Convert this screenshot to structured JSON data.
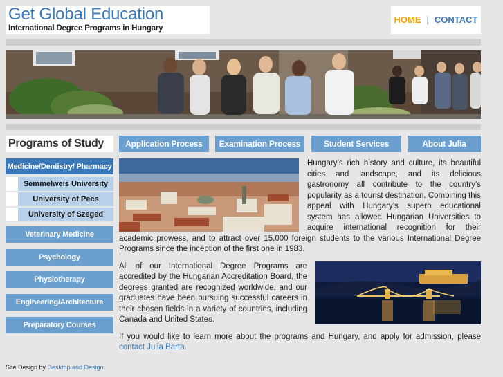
{
  "logo": {
    "title": "Get Global Education",
    "subtitle": "International Degree Programs in Hungary"
  },
  "topnav": {
    "home": "HOME",
    "separator": "|",
    "contact": "CONTACT"
  },
  "sidebar": {
    "heading": "Programs of Study",
    "items": [
      {
        "label": "Medicine/Dentistry/ Pharmacy"
      },
      {
        "label": "Veterinary Medicine"
      },
      {
        "label": "Psychology"
      },
      {
        "label": "Physiotherapy"
      },
      {
        "label": "Engineering/Architecture"
      },
      {
        "label": "Preparatory Courses"
      }
    ],
    "subitems": [
      {
        "label": "Semmelweis University"
      },
      {
        "label": "University of Pecs"
      },
      {
        "label": "University of Szeged"
      }
    ]
  },
  "tabs": [
    {
      "label": "Application Process"
    },
    {
      "label": "Examination Process"
    },
    {
      "label": "Student Services"
    },
    {
      "label": "About Julia"
    }
  ],
  "content": {
    "paragraph1": "Hungary’s rich history and culture, its beautiful cities and landscape, and its delicious gastronomy all contribute to the country’s popularity as a tourist destination. Combining this appeal with Hungary’s superb educational system has allowed Hungarian Universities to acquire international recognition for their academic prowess, and to attract over 15,000 foreign students to the various International Degree Programs since the inception of the first one in 1983.",
    "paragraph2": "All of our International Degree Programs are accredited by the Hungarian Accreditation Board, the degrees granted are recognized worldwide, and our graduates have been pursuing successful careers in their chosen fields in a variety of countries, including Canada and United States.",
    "paragraph3_text": "If you would like to learn more about the programs and Hungary, and apply for admission, please ",
    "paragraph3_link": "contact Julia Barta",
    "paragraph3_end": "."
  },
  "footer": {
    "prefix": "Site Design by ",
    "link": "Desktop and Design",
    "suffix": "."
  },
  "colors": {
    "accent": "#3a78b8",
    "button": "#6a9fd0",
    "home": "#f0a500",
    "background": "#e6e6e6"
  }
}
